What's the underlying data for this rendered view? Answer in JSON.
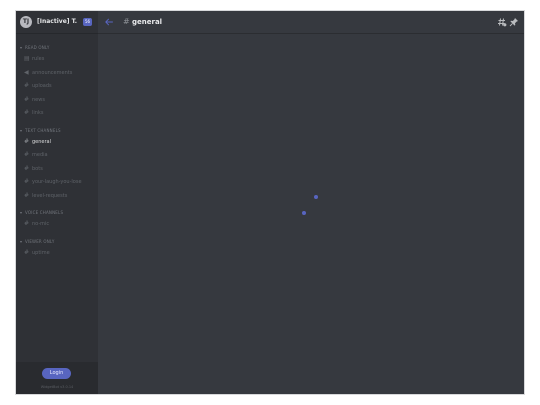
{
  "server": {
    "icon_text": "TJ",
    "name": "[Inactive] T...",
    "badge": "56"
  },
  "categories": [
    {
      "label": "READ ONLY",
      "channels": [
        {
          "name": "rules",
          "icon": "rules-icon",
          "glyph": "▤"
        },
        {
          "name": "announcements",
          "icon": "announcements-icon",
          "glyph": "◀"
        },
        {
          "name": "uploads",
          "icon": "hash-icon",
          "glyph": "#"
        },
        {
          "name": "news",
          "icon": "hash-icon",
          "glyph": "#"
        },
        {
          "name": "links",
          "icon": "hash-icon",
          "glyph": "#"
        }
      ]
    },
    {
      "label": "TEXT CHANNELS",
      "channels": [
        {
          "name": "general",
          "icon": "hash-icon",
          "glyph": "#",
          "active": true
        },
        {
          "name": "media",
          "icon": "hash-icon",
          "glyph": "#"
        },
        {
          "name": "bots",
          "icon": "hash-icon",
          "glyph": "#"
        },
        {
          "name": "your-laugh-you-lose",
          "icon": "hash-icon",
          "glyph": "#"
        },
        {
          "name": "level-requests",
          "icon": "hash-icon",
          "glyph": "#"
        }
      ]
    },
    {
      "label": "VOICE CHANNELS",
      "channels": [
        {
          "name": "no-mic",
          "icon": "hash-icon",
          "glyph": "#"
        }
      ]
    },
    {
      "label": "VIEWER ONLY",
      "channels": [
        {
          "name": "uptime",
          "icon": "hash-icon",
          "glyph": "#"
        }
      ]
    }
  ],
  "topbar": {
    "hash": "#",
    "channel_name": "general"
  },
  "footer": {
    "login_label": "Login",
    "version": "WidgetBot v3.0.14"
  },
  "colors": {
    "accent": "#5865c0",
    "background": "#36393f",
    "sidebar": "#2f3136"
  }
}
